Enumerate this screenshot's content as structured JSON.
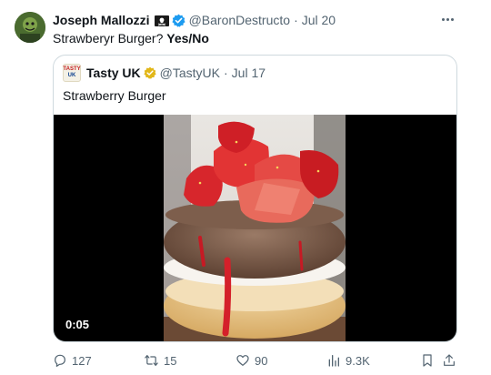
{
  "tweet": {
    "author_name": "Joseph Mallozzi",
    "handle": "@BaronDestructo",
    "separator": "·",
    "time": "Jul 20",
    "text_plain": "Strawberyr Burger?",
    "text_bold": "Yes/No"
  },
  "quote": {
    "avatar_line1": "TASTY",
    "avatar_line2": "UK",
    "author_name": "Tasty UK",
    "handle": "@TastyUK",
    "separator": "·",
    "time": "Jul 17",
    "text": "Strawberry Burger",
    "video_duration": "0:05"
  },
  "actions": {
    "replies": "127",
    "reposts": "15",
    "likes": "90",
    "views": "9.3K"
  },
  "icons": {
    "verified_badge": "blue-check",
    "quote_verified_badge": "gold-check",
    "name_emoji": "pirate-flag"
  },
  "colors": {
    "verified_blue": "#1d9bf0",
    "verified_gold": "#e2b719",
    "secondary_text": "#536471",
    "border": "#cfd9de"
  }
}
